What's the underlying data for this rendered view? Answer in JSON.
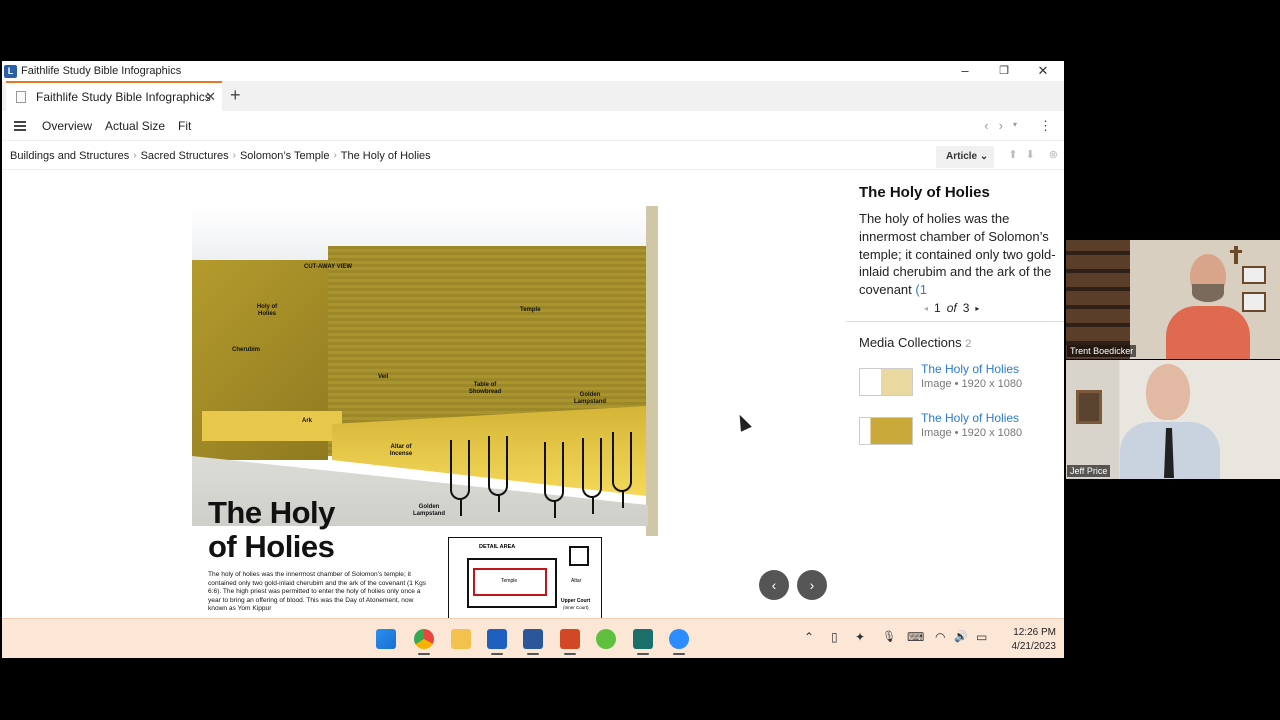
{
  "window": {
    "title": "Faithlife Study Bible Infographics",
    "minimize": "–",
    "restore": "❐",
    "close": "✕"
  },
  "tab": {
    "label": "Faithlife Study Bible Infographics",
    "close": "✕",
    "add": "+"
  },
  "toolbar": {
    "overview": "Overview",
    "actual_size": "Actual Size",
    "fit": "Fit",
    "back": "‹",
    "forward": "›",
    "history": "▾",
    "more": "⋮"
  },
  "breadcrumb": {
    "items": [
      "Buildings and Structures",
      "Sacred Structures",
      "Solomon’s Temple",
      "The Holy of Holies"
    ],
    "sep": "›",
    "article": "Article ⌄",
    "up": "⬆",
    "down": "⬇",
    "cancel": "⊗"
  },
  "infographic": {
    "cutaway": "CUT-AWAY VIEW",
    "labels": {
      "holy_of_holies": "Holy of Holies",
      "cherubim": "Cherubim",
      "veil": "Veil",
      "ark": "Ark",
      "temple": "Temple",
      "table": "Table of Showbread",
      "golden_lampstand": "Golden Lampstand",
      "altar": "Altar of Incense",
      "golden_lampstand_2": "Golden Lampstand"
    },
    "title_line1": "The Holy",
    "title_line2": "of Holies",
    "blurb": "The holy of holies was the innermost chamber of Solomon’s temple; it contained only two gold-inlaid cherubim and the ark of the covenant (1 Kgs 6:6). The high priest was permitted to enter the holy of holies only once a year to bring an offering of blood. This was the Day of Atonement, now known as Yom Kippur",
    "detail_area": "DETAIL AREA",
    "detail_temple": "Temple",
    "detail_altar": "Altar",
    "detail_upper": "Upper Court",
    "detail_inner": "(Inner Court)"
  },
  "nav": {
    "prev": "‹",
    "next": "›"
  },
  "panel": {
    "title": "The Holy of Holies",
    "description": "The holy of holies was the innermost chamber of Solomon’s temple; it contained only two gold-inlaid cherubim and the ark of the covenant ",
    "ref": "(1",
    "pager": {
      "current": "1",
      "of": "of",
      "total": "3",
      "prev": "◂",
      "next": "▸"
    },
    "media_title": "Media Collections",
    "media_count": "2",
    "media": [
      {
        "title": "The Holy of Holies",
        "sub": "Image • 1920 x 1080"
      },
      {
        "title": "The Holy of Holies",
        "sub": "Image • 1920 x 1080"
      }
    ]
  },
  "taskbar": {
    "time": "12:26 PM",
    "date": "4/21/2023",
    "tray": {
      "chevron": "⌃",
      "battery": "▯",
      "dropbox": "✦",
      "mic": "🎙",
      "keyboard": "⌨",
      "wifi": "◠",
      "volume": "🔊",
      "power": "▭"
    }
  },
  "participants": [
    {
      "name": "Trent Boedicker"
    },
    {
      "name": "Jeff Price"
    }
  ],
  "colors": {
    "accent_tab": "#e87722",
    "link": "#2a7bd4",
    "taskbar": "#fce6d6"
  }
}
